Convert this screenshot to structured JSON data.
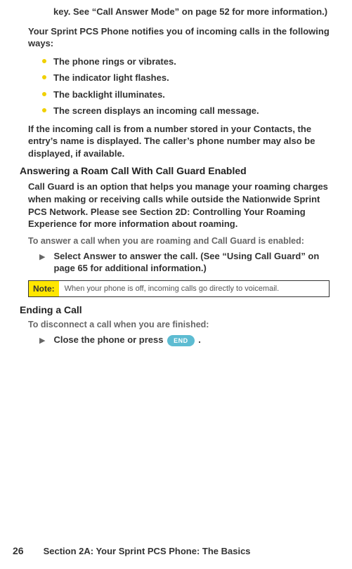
{
  "continuation": "key. See “Call Answer Mode” on page 52 for more information.)",
  "intro_para": "Your Sprint PCS Phone notifies you of incoming calls in the following ways:",
  "bullets": [
    "The phone rings or vibrates.",
    "The indicator light flashes.",
    "The backlight illuminates.",
    "The screen displays an incoming call message."
  ],
  "contacts_para": "If the incoming call is from a number stored in your Contacts, the entry’s name is displayed. The caller’s phone number may also be displayed, if available.",
  "roam_heading": "Answering a Roam Call With Call Guard Enabled",
  "roam_para": "Call Guard is an option that helps you manage your roaming charges when making or receiving calls while outside the Nationwide Sprint PCS Network. Please see Section 2D: Controlling Your Roaming Experience for more information about roaming.",
  "roam_sub": "To answer a call when you are roaming and Call Guard is enabled:",
  "step1_pre": "Select ",
  "step1_bold": "Answer",
  "step1_post": " to answer the call. (See “Using Call Guard” on page 65 for additional information.)",
  "note_label": "Note:",
  "note_text": "When your phone is off, incoming calls go directly to voicemail.",
  "ending_heading": "Ending a Call",
  "ending_sub": "To disconnect a call when you are finished:",
  "step2_pre": "Close the phone or press ",
  "end_key": "END",
  "step2_post": " .",
  "footer_page": "26",
  "footer_title": "Section 2A: Your Sprint PCS Phone: The Basics"
}
